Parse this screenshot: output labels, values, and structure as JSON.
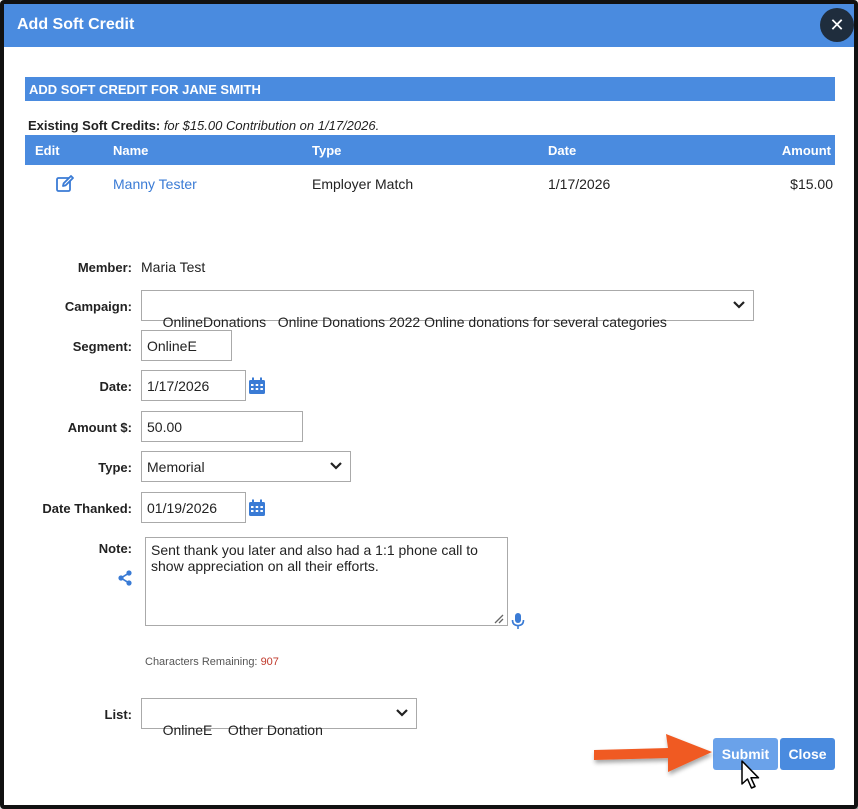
{
  "dialog": {
    "title": "Add Soft Credit",
    "close_label": "✕"
  },
  "section": {
    "header": "ADD SOFT CREDIT FOR JANE SMITH"
  },
  "existing": {
    "label": "Existing Soft Credits:",
    "description": "for $15.00 Contribution on 1/17/2026."
  },
  "table": {
    "headers": {
      "edit": "Edit",
      "name": "Name",
      "type": "Type",
      "date": "Date",
      "amount": "Amount"
    },
    "rows": [
      {
        "name": "Manny Tester",
        "type": "Employer Match",
        "date": "1/17/2026",
        "amount": "$15.00"
      }
    ]
  },
  "form": {
    "member_label": "Member:",
    "member_value": "Maria Test",
    "campaign_label": "Campaign:",
    "campaign_value": "OnlineDonations   Online Donations 2022 Online donations for several categories",
    "segment_label": "Segment:",
    "segment_value": "OnlineE",
    "date_label": "Date:",
    "date_value": "1/17/2026",
    "amount_label": "Amount $:",
    "amount_value": "50.00",
    "type_label": "Type:",
    "type_value": "Memorial",
    "date_thanked_label": "Date Thanked:",
    "date_thanked_value": "01/19/2026",
    "note_label": "Note:",
    "note_value": "Sent thank you later and also had a 1:1 phone call to show appreciation on all their efforts.",
    "chars_label": "Characters Remaining:",
    "chars_value": "907",
    "list_label": "List:",
    "list_value": "OnlineE    Other Donation"
  },
  "buttons": {
    "submit": "Submit",
    "close": "Close"
  },
  "colors": {
    "accent": "#4a8bdf",
    "arrow": "#f05a22"
  }
}
